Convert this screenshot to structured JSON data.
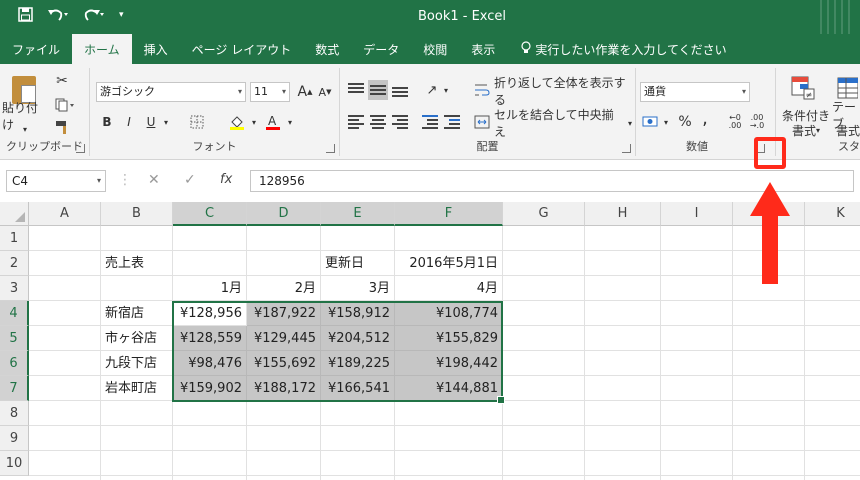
{
  "window": {
    "title": "Book1 - Excel",
    "qat": {
      "save_icon": "save-icon",
      "undo_icon": "undo-icon",
      "redo_icon": "redo-icon",
      "customize_icon": "chevron-down-icon"
    }
  },
  "tabs": [
    {
      "label": "ファイル",
      "active": false
    },
    {
      "label": "ホーム",
      "active": true
    },
    {
      "label": "挿入",
      "active": false
    },
    {
      "label": "ページ レイアウト",
      "active": false
    },
    {
      "label": "数式",
      "active": false
    },
    {
      "label": "データ",
      "active": false
    },
    {
      "label": "校閲",
      "active": false
    },
    {
      "label": "表示",
      "active": false
    }
  ],
  "tell_me": "実行したい作業を入力してください",
  "ribbon": {
    "clipboard": {
      "label": "クリップボード",
      "paste": "貼り付け"
    },
    "font": {
      "label": "フォント",
      "name": "游ゴシック",
      "size": "11",
      "bold": "B",
      "italic": "I",
      "underline": "U",
      "grow": "A",
      "shrink": "A"
    },
    "alignment": {
      "label": "配置",
      "wrap": "折り返して全体を表示する",
      "merge": "セルを結合して中央揃え"
    },
    "number": {
      "label": "数値",
      "format": "通貨",
      "percent": "%",
      "comma": ","
    },
    "styles": {
      "conditional": "条件付き",
      "conditional2": "書式",
      "table": "テーブ",
      "table2": "書式",
      "label": "スタ"
    }
  },
  "formula_bar": {
    "name_box": "C4",
    "cancel": "✕",
    "enter": "✓",
    "fx": "fx",
    "value": "128956"
  },
  "columns": [
    "A",
    "B",
    "C",
    "D",
    "E",
    "F",
    "G",
    "H",
    "I",
    "J",
    "K"
  ],
  "rows": [
    "1",
    "2",
    "3",
    "4",
    "5",
    "6",
    "7",
    "8",
    "9",
    "10"
  ],
  "sheet": {
    "title": "売上表",
    "updated_label": "更新日",
    "updated_value": "2016年5月1日",
    "months": [
      "1月",
      "2月",
      "3月",
      "4月"
    ],
    "stores": [
      {
        "name": "新宿店",
        "values": [
          "¥128,956",
          "¥187,922",
          "¥158,912",
          "¥108,774"
        ]
      },
      {
        "name": "市ヶ谷店",
        "values": [
          "¥128,559",
          "¥129,445",
          "¥204,512",
          "¥155,829"
        ]
      },
      {
        "name": "九段下店",
        "values": [
          "¥98,476",
          "¥155,692",
          "¥189,225",
          "¥198,442"
        ]
      },
      {
        "name": "岩本町店",
        "values": [
          "¥159,902",
          "¥188,172",
          "¥166,541",
          "¥144,881"
        ]
      }
    ]
  },
  "colors": {
    "excel_green": "#217346",
    "highlight_red": "#ff2a1a",
    "selection_gray": "#c6c6c6"
  }
}
